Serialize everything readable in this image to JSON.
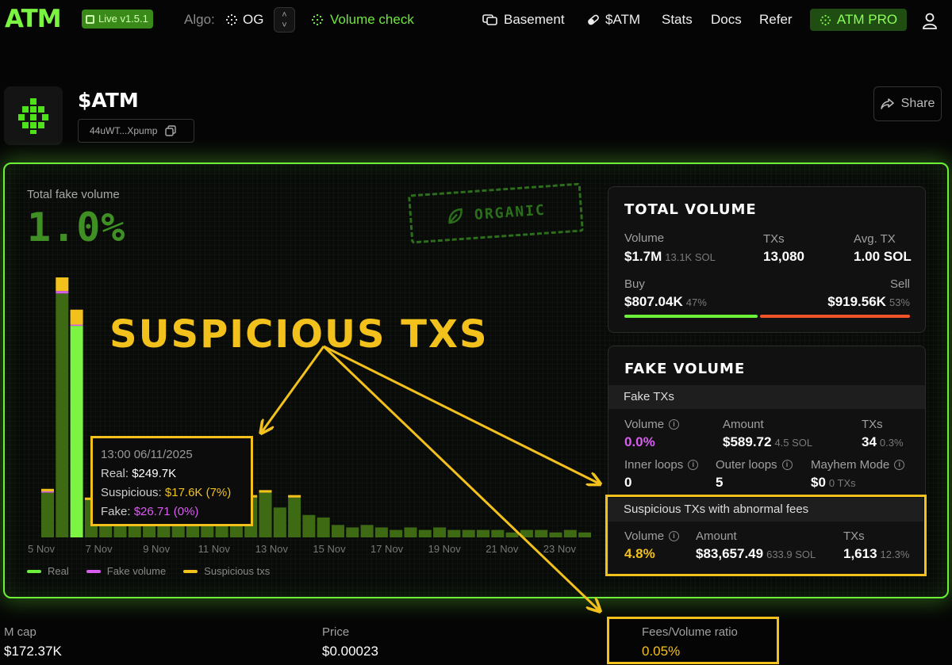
{
  "nav": {
    "logo": "ATM",
    "version_badge": "Live v1.5.1",
    "algo_label": "Algo:",
    "algo_value": "OG",
    "volume_check": "Volume check",
    "links": [
      "Basement",
      "$ATM",
      "Stats",
      "Docs",
      "Refer"
    ],
    "pro_button": "ATM PRO"
  },
  "token": {
    "name": "$ATM",
    "address": "44uWT...Xpump",
    "share_label": "Share"
  },
  "fake_summary": {
    "label": "Total fake volume",
    "value": "1.0%",
    "stamp": "ORGANIC"
  },
  "annotation": {
    "headline": "SUSPICIOUS TXS"
  },
  "tooltip": {
    "time": "13:00 06/11/2025",
    "real_label": "Real:",
    "real_value": "$249.7K",
    "suspicious_label": "Suspicious:",
    "suspicious_value": "$17.6K (7%)",
    "fake_label": "Fake:",
    "fake_value": "$26.71 (0%)"
  },
  "chart_data": {
    "type": "bar",
    "x_ticks": [
      "5 Nov",
      "7 Nov",
      "9 Nov",
      "11 Nov",
      "13 Nov",
      "15 Nov",
      "17 Nov",
      "19 Nov",
      "21 Nov",
      "23 Nov"
    ],
    "series": [
      {
        "name": "Real",
        "color": "#3f6a14",
        "values": [
          0.18,
          0.98,
          0.85,
          0.15,
          0.27,
          0.21,
          0.19,
          0.18,
          0.24,
          0.28,
          0.15,
          0.22,
          0.17,
          0.16,
          0.16,
          0.18,
          0.12,
          0.16,
          0.09,
          0.08,
          0.05,
          0.04,
          0.05,
          0.04,
          0.03,
          0.04,
          0.03,
          0.04,
          0.03,
          0.03,
          0.03,
          0.03,
          0.02,
          0.03,
          0.03,
          0.02,
          0.03,
          0.02,
          0.02,
          0.01
        ]
      },
      {
        "name": "Fake volume",
        "color": "#d85df0",
        "values": [
          0.005,
          0.01,
          0.005,
          0.0,
          0.005,
          0.0,
          0.0,
          0.0,
          0.0,
          0.0,
          0.0,
          0.0,
          0.0,
          0.0,
          0.0,
          0.0,
          0.0,
          0.0,
          0.0,
          0.0,
          0.0,
          0.0,
          0.0,
          0.0,
          0.0,
          0.0,
          0.0,
          0.0,
          0.0,
          0.0,
          0.0,
          0.0,
          0.0,
          0.0,
          0.0,
          0.0,
          0.0,
          0.0,
          0.0,
          0.0
        ]
      },
      {
        "name": "Suspicious txs",
        "color": "#f2c11c",
        "values": [
          0.01,
          0.08,
          0.06,
          0.01,
          0.02,
          0.01,
          0.01,
          0.01,
          0.02,
          0.02,
          0.01,
          0.01,
          0.01,
          0.01,
          0.01,
          0.01,
          0.0,
          0.01,
          0.0,
          0.0,
          0.0,
          0.0,
          0.0,
          0.0,
          0.0,
          0.0,
          0.0,
          0.0,
          0.0,
          0.0,
          0.0,
          0.0,
          0.0,
          0.0,
          0.0,
          0.0,
          0.0,
          0.0,
          0.0,
          0.0
        ]
      }
    ],
    "highlight_index": 2,
    "highlight_color": "#7cf542",
    "legend": [
      "Real",
      "Fake volume",
      "Suspicious txs"
    ]
  },
  "total_volume": {
    "title": "TOTAL VOLUME",
    "volume_label": "Volume",
    "volume_value": "$1.7M",
    "volume_sub": "13.1K SOL",
    "txs_label": "TXs",
    "txs_value": "13,080",
    "avg_label": "Avg. TX",
    "avg_value": "1.00 SOL",
    "buy_label": "Buy",
    "buy_value": "$807.04K",
    "buy_pct": "47%",
    "sell_label": "Sell",
    "sell_value": "$919.56K",
    "sell_pct": "53%",
    "buy_fraction": 0.47,
    "buy_color": "#6cf03a",
    "sell_color": "#f0532a"
  },
  "fake_volume": {
    "title": "FAKE VOLUME",
    "fake_txs_header": "Fake TXs",
    "volume_label": "Volume",
    "volume_value": "0.0%",
    "amount_label": "Amount",
    "amount_value": "$589.72",
    "amount_sub": "4.5 SOL",
    "txs_label": "TXs",
    "txs_value": "34",
    "txs_sub": "0.3%",
    "inner_label": "Inner loops",
    "inner_value": "0",
    "outer_label": "Outer loops",
    "outer_value": "5",
    "mayhem_label": "Mayhem Mode",
    "mayhem_value": "$0",
    "mayhem_sub": "0 TXs",
    "suspicious_header": "Suspicious TXs with abnormal fees",
    "sus_volume_label": "Volume",
    "sus_volume_value": "4.8%",
    "sus_amount_label": "Amount",
    "sus_amount_value": "$83,657.49",
    "sus_amount_sub": "633.9 SOL",
    "sus_txs_label": "TXs",
    "sus_txs_value": "1,613",
    "sus_txs_sub": "12.3%"
  },
  "bottom_stats": {
    "mcap_label": "M cap",
    "mcap_value": "$172.37K",
    "price_label": "Price",
    "price_value": "$0.00023",
    "fees_label": "Fees/Volume ratio",
    "fees_value": "0.05%"
  }
}
